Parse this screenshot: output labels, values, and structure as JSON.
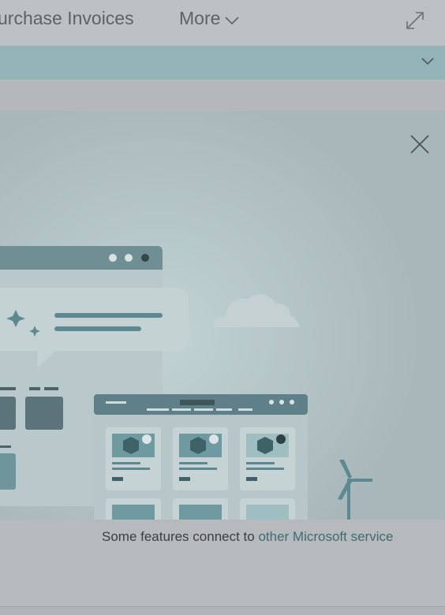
{
  "header": {
    "nav_invoices": "urchase Invoices",
    "nav_more": "More"
  },
  "footer": {
    "text_prefix": "Some features connect to ",
    "link_text": "other Microsoft service"
  },
  "icons": {
    "more": "chevron-down-icon",
    "expand": "expand-icon",
    "section": "chevron-down-icon",
    "close": "close-icon"
  },
  "colors": {
    "overlay_tint": "#b5b9bb",
    "accent_bar": "#94b3b7",
    "panel": "#a8b8ba",
    "link": "#3f6a73"
  }
}
